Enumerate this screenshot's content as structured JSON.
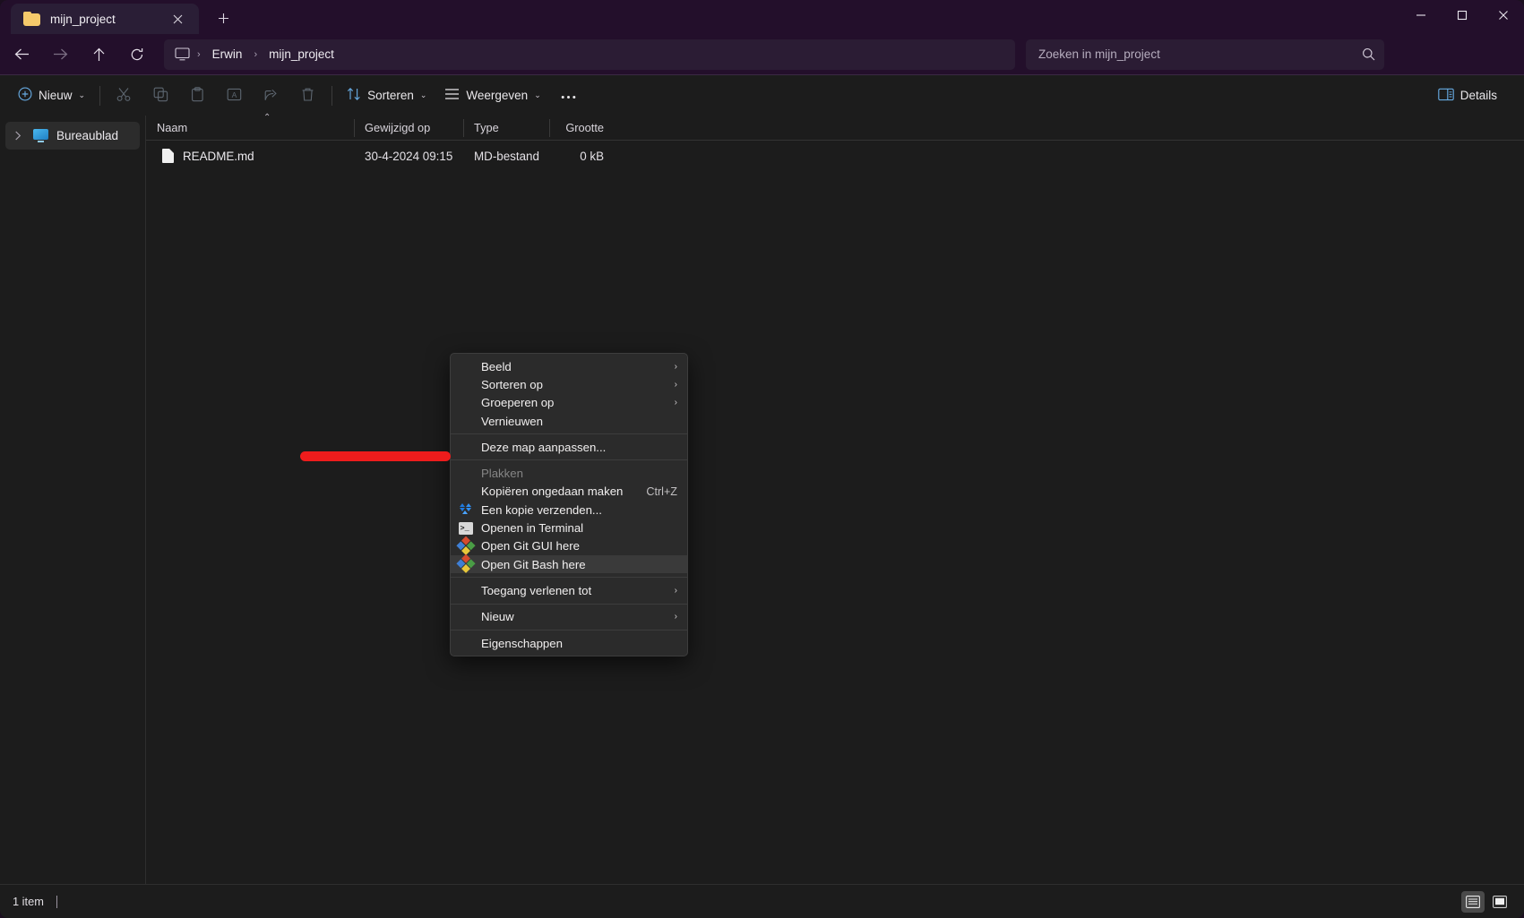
{
  "window": {
    "tab_title": "mijn_project",
    "tab_icon": "folder-icon",
    "close_tab_icon": "close-icon",
    "new_tab_icon": "plus-icon",
    "minimize_icon": "minimize-icon",
    "maximize_icon": "maximize-icon",
    "close_icon": "close-icon"
  },
  "address": {
    "back_icon": "arrow-left-icon",
    "forward_icon": "arrow-right-icon",
    "up_icon": "arrow-up-icon",
    "refresh_icon": "refresh-icon",
    "root_icon": "this-pc-icon",
    "crumbs": [
      "Erwin",
      "mijn_project"
    ],
    "separator": "›"
  },
  "search": {
    "placeholder": "Zoeken in mijn_project",
    "value": "",
    "icon": "search-icon"
  },
  "toolbar": {
    "new_label": "Nieuw",
    "new_icon": "plus-circle-icon",
    "cut_icon": "scissors-icon",
    "copy_icon": "copy-icon",
    "paste_icon": "paste-icon",
    "rename_icon": "rename-icon",
    "share_icon": "share-icon",
    "delete_icon": "trash-icon",
    "sort_label": "Sorteren",
    "sort_icon": "sort-arrows-icon",
    "view_label": "Weergeven",
    "view_icon": "list-lines-icon",
    "more_icon": "ellipsis-icon",
    "details_label": "Details",
    "details_icon": "details-pane-icon",
    "chevron": "⌄"
  },
  "sidebar": {
    "items": [
      {
        "label": "Bureaublad",
        "icon": "monitor-icon",
        "expand_icon": "chevron-right-icon",
        "selected": true
      }
    ]
  },
  "columns": {
    "name": "Naam",
    "modified": "Gewijzigd op",
    "type": "Type",
    "size": "Grootte",
    "sort_caret": "⌃"
  },
  "files": [
    {
      "name": "README.md",
      "icon": "file-icon",
      "modified": "30-4-2024 09:15",
      "type": "MD-bestand",
      "size": "0 kB"
    }
  ],
  "context_menu": {
    "items": [
      {
        "label": "Beeld",
        "submenu": true,
        "icon": null,
        "accel": "",
        "disabled": false,
        "highlight": false
      },
      {
        "label": "Sorteren op",
        "submenu": true,
        "icon": null,
        "accel": "",
        "disabled": false,
        "highlight": false
      },
      {
        "label": "Groeperen op",
        "submenu": true,
        "icon": null,
        "accel": "",
        "disabled": false,
        "highlight": false
      },
      {
        "label": "Vernieuwen",
        "submenu": false,
        "icon": null,
        "accel": "",
        "disabled": false,
        "highlight": false
      },
      {
        "separator": true
      },
      {
        "label": "Deze map aanpassen...",
        "submenu": false,
        "icon": null,
        "accel": "",
        "disabled": false,
        "highlight": false
      },
      {
        "separator": true
      },
      {
        "label": "Plakken",
        "submenu": false,
        "icon": null,
        "accel": "",
        "disabled": true,
        "highlight": false
      },
      {
        "label": "Kopiëren ongedaan maken",
        "submenu": false,
        "icon": null,
        "accel": "Ctrl+Z",
        "disabled": false,
        "highlight": false
      },
      {
        "label": "Een kopie verzenden...",
        "submenu": false,
        "icon": "dropbox-icon",
        "accel": "",
        "disabled": false,
        "highlight": false
      },
      {
        "label": "Openen in Terminal",
        "submenu": false,
        "icon": "terminal-icon",
        "accel": "",
        "disabled": false,
        "highlight": false
      },
      {
        "label": "Open Git GUI here",
        "submenu": false,
        "icon": "git-icon",
        "accel": "",
        "disabled": false,
        "highlight": false
      },
      {
        "label": "Open Git Bash here",
        "submenu": false,
        "icon": "git-icon",
        "accel": "",
        "disabled": false,
        "highlight": true
      },
      {
        "separator": true
      },
      {
        "label": "Toegang verlenen tot",
        "submenu": true,
        "icon": null,
        "accel": "",
        "disabled": false,
        "highlight": false
      },
      {
        "separator": true
      },
      {
        "label": "Nieuw",
        "submenu": true,
        "icon": null,
        "accel": "",
        "disabled": false,
        "highlight": false
      },
      {
        "separator": true
      },
      {
        "label": "Eigenschappen",
        "submenu": false,
        "icon": null,
        "accel": "",
        "disabled": false,
        "highlight": false
      }
    ],
    "submenu_arrow": "›"
  },
  "annotation": {
    "color": "#ee1c1c",
    "shape": "red-underline-stroke"
  },
  "status": {
    "item_count": "1 item",
    "details_view_icon": "details-view-icon",
    "large_icons_view_icon": "large-icons-view-icon"
  }
}
